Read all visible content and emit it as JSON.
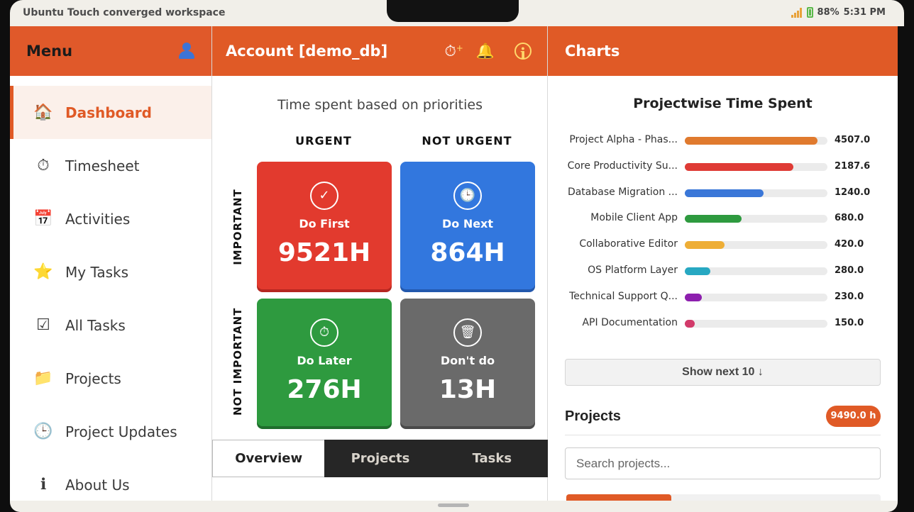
{
  "window": {
    "title": "Ubuntu Touch converged workspace"
  },
  "status": {
    "battery": "88%",
    "time": "5:31 PM",
    "signal_icon": "signal-icon",
    "battery_icon": "battery-icon"
  },
  "menu": {
    "title": "Menu",
    "user_icon": "user-icon",
    "items": [
      {
        "label": "Dashboard",
        "icon": "🏠",
        "active": true
      },
      {
        "label": "Timesheet",
        "icon": "⏱"
      },
      {
        "label": "Activities",
        "icon": "📅"
      },
      {
        "label": "My Tasks",
        "icon": "⭐"
      },
      {
        "label": "All Tasks",
        "icon": "☑"
      },
      {
        "label": "Projects",
        "icon": "📁"
      },
      {
        "label": "Project Updates",
        "icon": "🕒"
      },
      {
        "label": "About Us",
        "icon": "ℹ"
      }
    ]
  },
  "account": {
    "title": "Account [demo_db]",
    "icons": {
      "timer": "⏱",
      "timer_plus": "+",
      "bell": "🔔",
      "info": "i"
    },
    "quadrant": {
      "title": "Time spent based on priorities",
      "col_urgent": "URGENT",
      "col_not_urgent": "NOT URGENT",
      "row_important": "IMPORTANT",
      "row_not_important": "NOT IMPORTANT",
      "tiles": {
        "do_first": {
          "label": "Do First",
          "value": "9521H",
          "icon": "✓"
        },
        "do_next": {
          "label": "Do Next",
          "value": "864H",
          "icon": "🕒"
        },
        "do_later": {
          "label": "Do Later",
          "value": "276H",
          "icon": "⏱"
        },
        "dont_do": {
          "label": "Don't do",
          "value": "13H",
          "icon": "🗑"
        }
      }
    },
    "tabs": [
      "Overview",
      "Projects",
      "Tasks"
    ]
  },
  "charts": {
    "title": "Charts",
    "show_next": "Show next 10 ↓",
    "projects_heading": "Projects",
    "projects_total": "9490.0 h",
    "search_placeholder": "Search projects..."
  },
  "chart_data": {
    "type": "bar",
    "title": "Projectwise Time Spent",
    "categories": [
      "Project Alpha - Phas...",
      "Core Productivity Su...",
      "Database Migration ...",
      "Mobile Client App",
      "Collaborative Editor",
      "OS Platform Layer",
      "Technical Support Q...",
      "API Documentation"
    ],
    "values": [
      4507.0,
      2187.6,
      1240.0,
      680.0,
      420.0,
      280.0,
      230.0,
      150.0
    ],
    "value_labels": [
      "4507.0",
      "2187.6",
      "1240.0",
      "680.0",
      "420.0",
      "280.0",
      "230.0",
      "150.0"
    ],
    "fill_fractions": [
      0.93,
      0.76,
      0.55,
      0.4,
      0.28,
      0.18,
      0.12,
      0.07
    ],
    "colors": [
      "#e07a2e",
      "#df3b35",
      "#3a77d8",
      "#2e9a3f",
      "#eeae36",
      "#27a8c2",
      "#8d1fae",
      "#d23a6a"
    ],
    "orientation": "horizontal"
  }
}
